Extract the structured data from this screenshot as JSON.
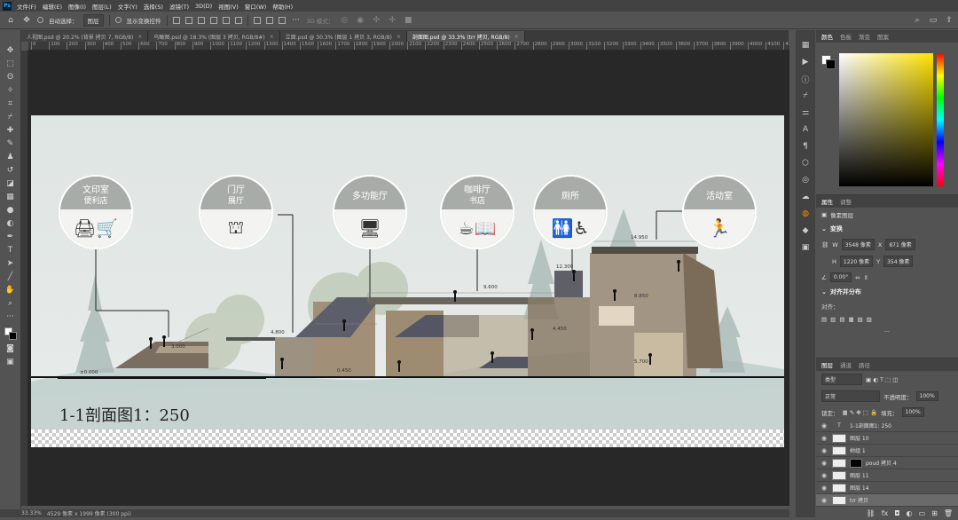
{
  "menubar": {
    "logo": "Ps",
    "items": [
      "文件(F)",
      "编辑(E)",
      "图像(I)",
      "图层(L)",
      "文字(Y)",
      "选择(S)",
      "滤镜(T)",
      "3D(D)",
      "视图(V)",
      "窗口(W)",
      "帮助(H)"
    ]
  },
  "options": {
    "auto_select_label": "自动选择：",
    "auto_select_value": "图层",
    "transform_label": "显示变换控件",
    "mode_3d": "3D 模式："
  },
  "tabs": [
    {
      "label": "人视图.psd @ 20.2% (背景 拷贝 7, RGB/8)",
      "active": false
    },
    {
      "label": "鸟瞰图.psd @ 18.3% (图层 3 拷贝, RGB/8#)",
      "active": false
    },
    {
      "label": "立面.psd @ 30.3% (图层 1 拷贝 3, RGB/8)",
      "active": false
    },
    {
      "label": "剖面图.psd @ 33.3% (trr 拷贝, RGB/8)",
      "active": true
    }
  ],
  "ruler_ticks": [
    "0",
    "100",
    "200",
    "300",
    "400",
    "500",
    "600",
    "700",
    "800",
    "900",
    "1000",
    "1100",
    "1200",
    "1300",
    "1400",
    "1500",
    "1600",
    "1700",
    "1800",
    "1900",
    "2000",
    "2100",
    "2200",
    "2300",
    "2400",
    "2500",
    "2600",
    "2700",
    "2800",
    "2900",
    "3000",
    "3100",
    "3200",
    "3300",
    "3400",
    "3500",
    "3600",
    "3700",
    "3800",
    "3900",
    "4000",
    "4100",
    "4200"
  ],
  "drawing": {
    "title": "1-1剖面图1：250",
    "bubbles": [
      {
        "line1": "文印室",
        "line2": "便利店",
        "icon": "🖨🛒"
      },
      {
        "line1": "门厅",
        "line2": "展厅",
        "icon": "⛫"
      },
      {
        "line1": "多功能厅",
        "line2": "",
        "icon": "🖥"
      },
      {
        "line1": "咖啡厅",
        "line2": "书店",
        "icon": "☕📖"
      },
      {
        "line1": "厕所",
        "line2": "",
        "icon": "🚻♿"
      },
      {
        "line1": "活动室",
        "line2": "",
        "icon": "🏃"
      }
    ],
    "elevations": [
      "3.000",
      "±0.000",
      "4.800",
      "9.600",
      "12.300",
      "8.850",
      "4.450",
      "5.700",
      "14.950",
      "0.450"
    ]
  },
  "status": {
    "zoom": "33.33%",
    "doc_info": "4529 像素 x 1999 像素 (300 ppi)"
  },
  "color_panel": {
    "tabs": [
      "颜色",
      "色板",
      "渐变",
      "图案"
    ]
  },
  "props_panel": {
    "tabs": [
      "属性",
      "调整"
    ],
    "layer_type": "像素图层",
    "transform_label": "变换",
    "w": "3548 像素",
    "x": "871 像素",
    "h": "1220 像素",
    "y": "354 像素",
    "angle": "0.00°",
    "align_label": "对齐并分布",
    "align_sub": "对齐："
  },
  "layers_panel": {
    "tabs": [
      "图层",
      "通道",
      "路径"
    ],
    "filter": "类型",
    "blend": "正常",
    "opacity_label": "不透明度：",
    "opacity": "100%",
    "lock_label": "锁定：",
    "fill_label": "填充：",
    "fill": "100%",
    "layers": [
      {
        "name": "1-1剖面图1: 250",
        "type": "text"
      },
      {
        "name": "图层 10",
        "type": "pixel"
      },
      {
        "name": "树组 1",
        "type": "pixel"
      },
      {
        "name": "poud 拷贝 4",
        "type": "mask"
      },
      {
        "name": "图层 11",
        "type": "pixel"
      },
      {
        "name": "图层 14",
        "type": "pixel"
      },
      {
        "name": "trr 拷贝",
        "type": "pixel",
        "selected": true
      }
    ]
  }
}
